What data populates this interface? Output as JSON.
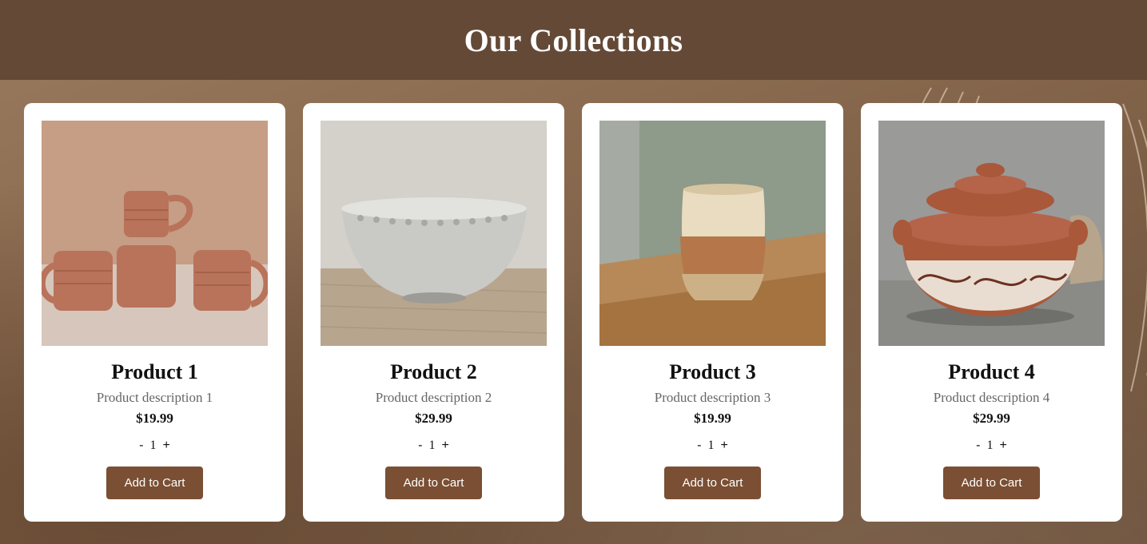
{
  "header": {
    "title": "Our Collections"
  },
  "products": [
    {
      "name": "Product 1",
      "description": "Product description 1",
      "price": "$19.99",
      "qty": "1",
      "minus": "-",
      "plus": "+",
      "button": "Add to Cart",
      "image_icon": "mugs-stack-image"
    },
    {
      "name": "Product 2",
      "description": "Product description 2",
      "price": "$29.99",
      "qty": "1",
      "minus": "-",
      "plus": "+",
      "button": "Add to Cart",
      "image_icon": "textured-bowl-image"
    },
    {
      "name": "Product 3",
      "description": "Product description 3",
      "price": "$19.99",
      "qty": "1",
      "minus": "-",
      "plus": "+",
      "button": "Add to Cart",
      "image_icon": "glazed-cup-image"
    },
    {
      "name": "Product 4",
      "description": "Product description 4",
      "price": "$29.99",
      "qty": "1",
      "minus": "-",
      "plus": "+",
      "button": "Add to Cart",
      "image_icon": "lidded-pot-image"
    }
  ],
  "colors": {
    "header_bg": "#644937",
    "button_bg": "#7a4f33",
    "card_bg": "#ffffff"
  }
}
